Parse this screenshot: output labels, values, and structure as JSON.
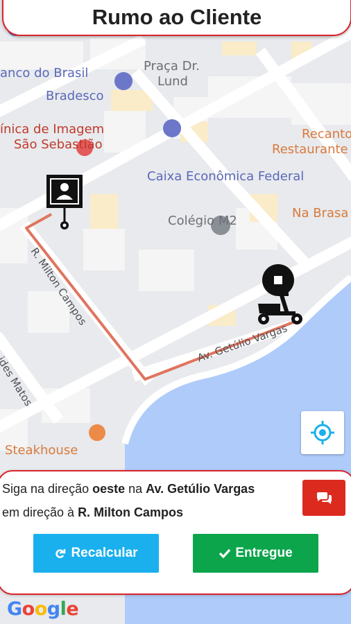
{
  "header": {
    "title": "Rumo ao Cliente"
  },
  "map": {
    "pois": [
      {
        "name": "banco-do-brasil",
        "text": "anco do Brasil",
        "color": "#5b68b8"
      },
      {
        "name": "praca-dr-lund-1",
        "text": "Praça Dr.",
        "color": "#6b6f75"
      },
      {
        "name": "praca-dr-lund-2",
        "text": "Lund",
        "color": "#6b6f75"
      },
      {
        "name": "bradesco",
        "text": "Bradesco",
        "color": "#5b68b8"
      },
      {
        "name": "clinica-1",
        "text": "ínica de Imagem",
        "color": "#c0392b"
      },
      {
        "name": "clinica-2",
        "text": "São Sebastião",
        "color": "#c0392b"
      },
      {
        "name": "recanto-1",
        "text": "Recanto",
        "color": "#d97a3c"
      },
      {
        "name": "recanto-2",
        "text": "Restaurante",
        "color": "#d97a3c"
      },
      {
        "name": "caixa",
        "text": "Caixa Econômica Federal",
        "color": "#5b68b8"
      },
      {
        "name": "na-brasa",
        "text": "Na Brasa",
        "color": "#d97a3c"
      },
      {
        "name": "colegio",
        "text": "Colégio M2",
        "color": "#6b6f75"
      },
      {
        "name": "steakhouse",
        "text": "Steakhouse",
        "color": "#d97a3c"
      }
    ],
    "streets": {
      "milton": "R. Milton Campos",
      "getulio": "Av. Getúlio Vargas",
      "matos": "ides Matos"
    },
    "google_logo": {
      "G": "G",
      "o1": "o",
      "o2": "o",
      "g": "g",
      "l": "l",
      "e": "e"
    }
  },
  "instruction": {
    "part1": "Siga na direção ",
    "direction": "oeste",
    "part2": " na ",
    "street": "Av. Getúlio Vargas",
    "part3": "em direção à ",
    "target": "R. Milton Campos"
  },
  "buttons": {
    "recalc_label": "Recalcular",
    "entregue_label": "Entregue"
  },
  "colors": {
    "accent_red": "#d8232a",
    "recalc_blue": "#1ab0ee",
    "entregue_green": "#0ca54c",
    "route": "#e0745e",
    "water": "#aecbfa"
  }
}
